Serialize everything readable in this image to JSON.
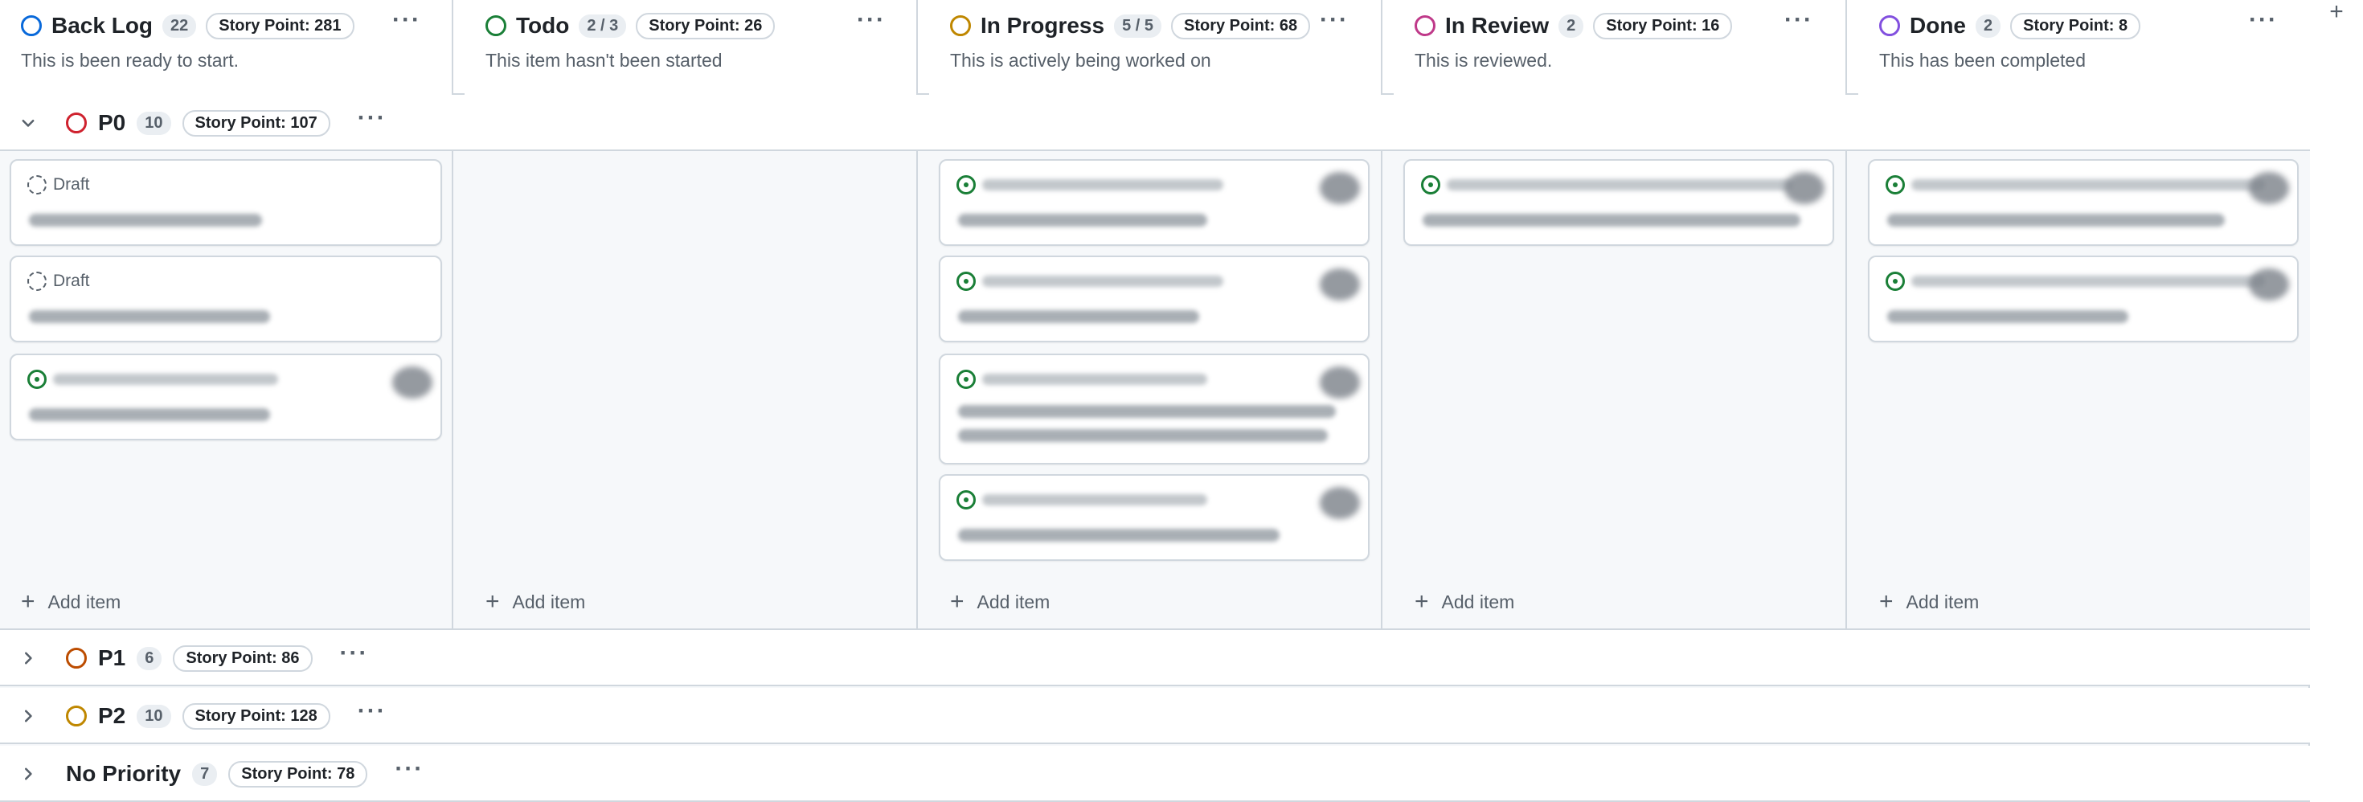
{
  "columns": [
    {
      "id": "backlog",
      "title": "Back Log",
      "count": "22",
      "story_point": "Story Point: 281",
      "description": "This is been ready to start.",
      "color": "#0969da"
    },
    {
      "id": "todo",
      "title": "Todo",
      "count": "2 / 3",
      "story_point": "Story Point: 26",
      "description": "This item hasn't been started",
      "color": "#1a7f37"
    },
    {
      "id": "inprogress",
      "title": "In Progress",
      "count": "5 / 5",
      "story_point": "Story Point: 68",
      "description": "This is actively being worked on",
      "color": "#bf8700"
    },
    {
      "id": "inreview",
      "title": "In Review",
      "count": "2",
      "story_point": "Story Point: 16",
      "description": "This is reviewed.",
      "color": "#bf3989"
    },
    {
      "id": "done",
      "title": "Done",
      "count": "2",
      "story_point": "Story Point: 8",
      "description": "This has been completed",
      "color": "#8250df"
    }
  ],
  "groups": [
    {
      "id": "p0",
      "title": "P0",
      "count": "10",
      "story_point": "Story Point: 107",
      "color": "#cf222e",
      "expanded": true
    },
    {
      "id": "p1",
      "title": "P1",
      "count": "6",
      "story_point": "Story Point: 86",
      "color": "#bc4c00",
      "expanded": false
    },
    {
      "id": "p2",
      "title": "P2",
      "count": "10",
      "story_point": "Story Point: 128",
      "color": "#bf8700",
      "expanded": false
    },
    {
      "id": "nopriority",
      "title": "No Priority",
      "count": "7",
      "story_point": "Story Point: 78",
      "expanded": false
    }
  ],
  "cards": {
    "draft_label": "Draft"
  },
  "add_item_label": "Add item",
  "more_glyph": "···",
  "plus_glyph": "+",
  "icons": {
    "more": "kebab-horizontal-icon",
    "add": "plus-icon",
    "expand": "chevron-icon"
  }
}
